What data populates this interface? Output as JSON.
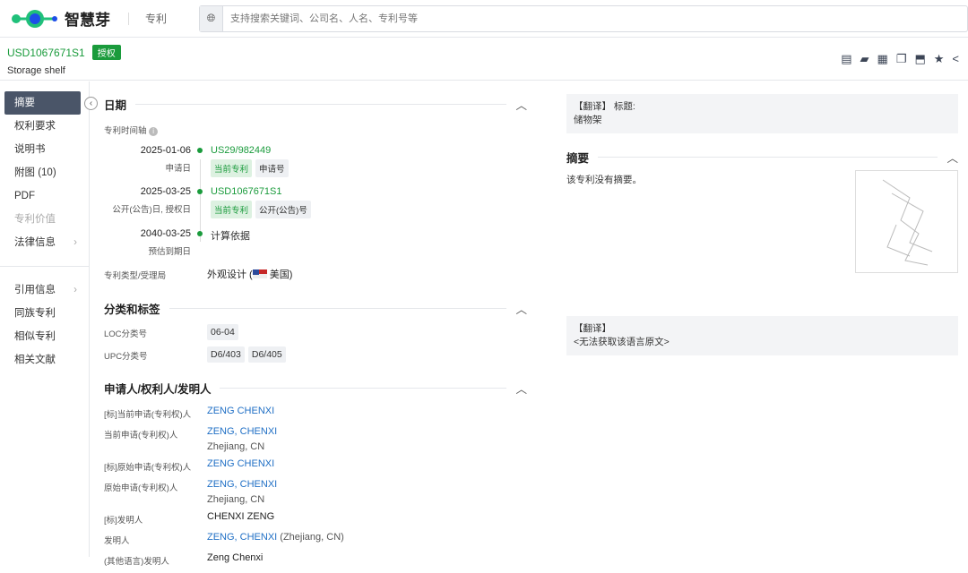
{
  "top": {
    "brand": "智慧芽",
    "nav": "专利",
    "search_placeholder": "支持搜索关键词、公司名、人名、专利号等"
  },
  "header": {
    "number": "USD1067671S1",
    "status": "授权",
    "title": "Storage shelf"
  },
  "sidebar": [
    "摘要",
    "权利要求",
    "说明书",
    "附图 (10)",
    "PDF",
    "专利价值",
    "法律信息",
    "引用信息",
    "同族专利",
    "相似专利",
    "相关文献"
  ],
  "dates": {
    "title": "日期",
    "timeline_label": "专利时间轴",
    "events": [
      {
        "date": "2025-01-06",
        "sub": "申请日",
        "link": "US29/982449",
        "tags": [
          "当前专利",
          "申请号"
        ]
      },
      {
        "date": "2025-03-25",
        "sub": "公开(公告)日, 授权日",
        "link": "USD1067671S1",
        "tags": [
          "当前专利",
          "公开(公告)号"
        ]
      },
      {
        "date": "2040-03-25",
        "sub": "预估到期日",
        "link": "计算依据"
      }
    ],
    "type_label": "专利类型/受理局",
    "type_value": "外观设计 (",
    "country": "美国)"
  },
  "classification": {
    "title": "分类和标签",
    "loc_label": "LOC分类号",
    "loc": "06-04",
    "upc_label": "UPC分类号",
    "upc": [
      "D6/403",
      "D6/405"
    ]
  },
  "parties": {
    "title": "申请人/权利人/发明人",
    "rows": [
      {
        "k": "[标]当前申请(专利权)人",
        "v": "ZENG CHENXI",
        "link": true
      },
      {
        "k": "当前申请(专利权)人",
        "v": "ZENG, CHENXI",
        "link": true,
        "loc": "Zhejiang, CN"
      },
      {
        "k": "[标]原始申请(专利权)人",
        "v": "ZENG CHENXI",
        "link": true
      },
      {
        "k": "原始申请(专利权)人",
        "v": "ZENG, CHENXI",
        "link": true,
        "loc": "Zhejiang, CN"
      },
      {
        "k": "[标]发明人",
        "v": "CHENXI ZENG"
      },
      {
        "k": "发明人",
        "v": "ZENG, CHENXI",
        "link": true,
        "extra": " (Zhejiang, CN)"
      },
      {
        "k": "(其他语言)发明人",
        "v": "Zeng Chenxi"
      }
    ]
  },
  "right": {
    "trans_tag": "【翻译】",
    "title_label": "标题:",
    "title_value": "储物架",
    "abstract_title": "摘要",
    "abstract_text": "该专利没有摘要。",
    "trans2": "【翻译】",
    "trans2_text": "<无法获取该语言原文>"
  }
}
